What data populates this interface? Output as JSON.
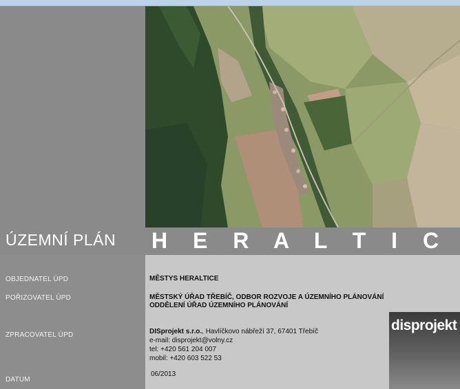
{
  "header": {
    "doc_type": "ÚZEMNÍ PLÁN",
    "municipality": "H E R A L T I C E"
  },
  "rows": {
    "objednatel": {
      "label": "OBJEDNATEL ÚPD",
      "value": "MĚSTYS HERALTICE"
    },
    "porizovatel": {
      "label": "POŘIZOVATEL ÚPD",
      "value_line1": "MĚSTSKÝ ÚŘAD TŘEBÍČ, ODBOR ROZVOJE A ÚZEMNÍHO PLÁNOVÁNÍ",
      "value_line2": "ODDĚLENÍ  ÚŘAD ÚZEMNÍHO PLÁNOVÁNÍ"
    },
    "zpracovatel": {
      "label": "ZPRACOVATEL ÚPD",
      "company": "DISprojekt  s.r.o.",
      "address": ", Havlíčkovo nábřeží 37, 67401 Třebíč",
      "email": "e-mail: disprojekt@volny.cz",
      "tel": "tel: +420 561 204 007",
      "mobil": "mobil: +420 603 522 53"
    },
    "datum": {
      "label": "DATUM",
      "value": "06/2013"
    }
  },
  "logo": {
    "text": "disprojekt"
  },
  "colors": {
    "panel_gray": "#8a8a8a",
    "content_gray": "#c8c8c8",
    "topbar": "#bcd3ea"
  }
}
